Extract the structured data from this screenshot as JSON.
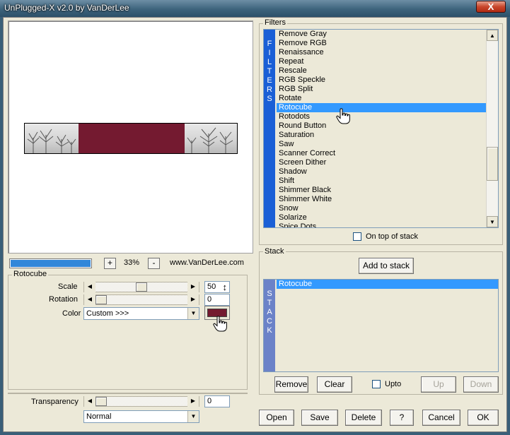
{
  "window": {
    "title": "UnPlugged-X v2.0 by VanDerLee",
    "close_glyph": "X"
  },
  "preview": {
    "zoom_minus": "-",
    "zoom_plus": "+",
    "zoom_level": "33%",
    "website": "www.VanDerLee.com",
    "progress_fraction": 1.0,
    "fill_color": "#741a30"
  },
  "params": {
    "group_title": "Rotocube",
    "scale_label": "Scale",
    "scale_value": "50",
    "scale_fraction": 0.5,
    "rotation_label": "Rotation",
    "rotation_value": "0",
    "rotation_fraction": 0.0,
    "color_label": "Color",
    "color_select": "Custom >>>",
    "color_swatch": "#741a30",
    "transparency_label": "Transparency",
    "transparency_value": "0",
    "transparency_fraction": 0.0,
    "blend_mode": "Normal"
  },
  "filters": {
    "group_title": "Filters",
    "band_letters": [
      "F",
      "I",
      "L",
      "T",
      "E",
      "R",
      "S"
    ],
    "items": [
      "Remove Gray",
      "Remove RGB",
      "Renaissance",
      "Repeat",
      "Rescale",
      "RGB Speckle",
      "RGB Split",
      "Rotate",
      "Rotocube",
      "Rotodots",
      "Round Button",
      "Saturation",
      "Saw",
      "Scanner Correct",
      "Screen Dither",
      "Shadow",
      "Shift",
      "Shimmer Black",
      "Shimmer White",
      "Snow",
      "Solarize",
      "Spice Dots"
    ],
    "selected": "Rotocube",
    "on_top_label": "On top of stack",
    "on_top_checked": false
  },
  "stack": {
    "group_title": "Stack",
    "add_label": "Add to stack",
    "band_letters": [
      "S",
      "T",
      "A",
      "C",
      "K"
    ],
    "items": [
      "Rotocube"
    ],
    "remove_label": "Remove",
    "clear_label": "Clear",
    "upto_label": "Upto",
    "upto_checked": false,
    "up_label": "Up",
    "down_label": "Down"
  },
  "footer": {
    "open_label": "Open",
    "save_label": "Save",
    "delete_label": "Delete",
    "help_label": "?",
    "cancel_label": "Cancel",
    "ok_label": "OK"
  },
  "icons": {
    "arrow_left": "◀",
    "arrow_right": "▶",
    "arrow_up": "▲",
    "arrow_down": "▼",
    "spin": "↕"
  },
  "colors": {
    "band_blue": "#1a5fd6",
    "band_slate": "#6b82c8",
    "selection": "#3399ff"
  }
}
